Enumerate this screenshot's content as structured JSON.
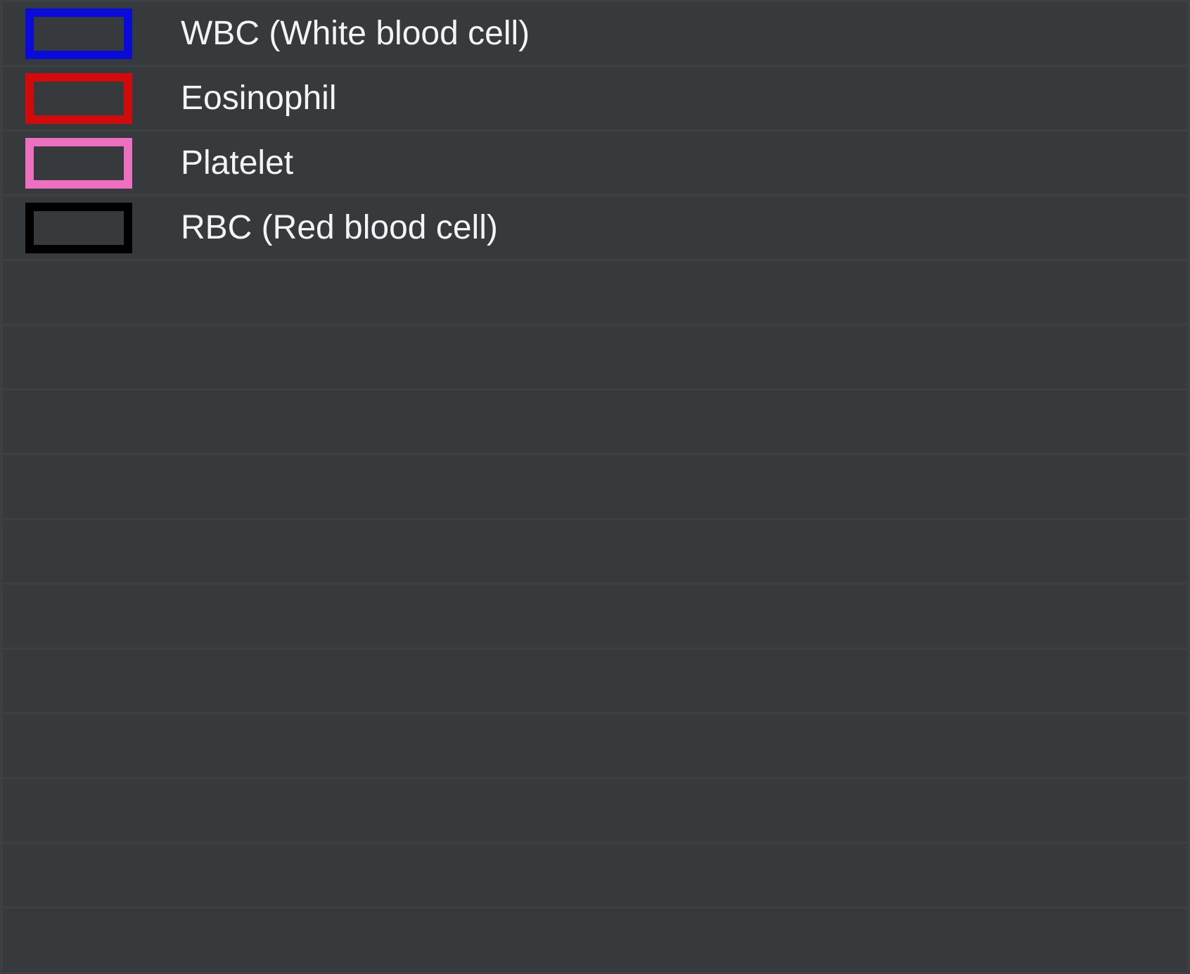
{
  "legend": {
    "items": [
      {
        "label": "WBC (White blood cell)",
        "color": "#0b0bd9"
      },
      {
        "label": "Eosinophil",
        "color": "#d10a0a"
      },
      {
        "label": "Platelet",
        "color": "#ed6fc0"
      },
      {
        "label": "RBC (Red blood cell)",
        "color": "#000000"
      }
    ],
    "empty_rows": 11
  }
}
